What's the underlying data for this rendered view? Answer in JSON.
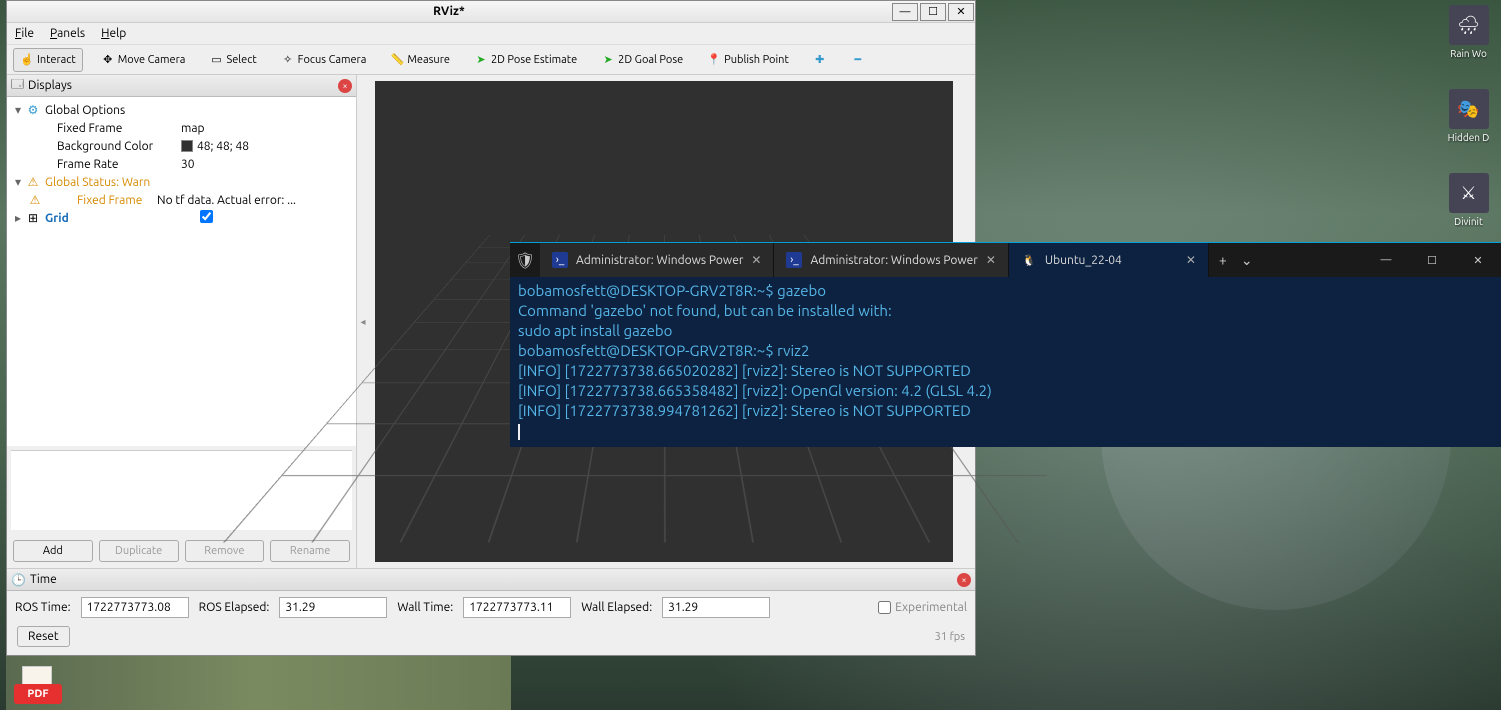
{
  "desktop": {
    "right_icons": [
      {
        "label": "Rain Wo"
      },
      {
        "label": "Hidden D"
      },
      {
        "label": "Divinit"
      }
    ],
    "pdf_label": "PDF"
  },
  "rviz": {
    "title": "RViz*",
    "menu": {
      "file": "File",
      "panels": "Panels",
      "help": "Help"
    },
    "toolbar": {
      "interact": "Interact",
      "move_camera": "Move Camera",
      "select": "Select",
      "focus_camera": "Focus Camera",
      "measure": "Measure",
      "pose_estimate": "2D Pose Estimate",
      "goal_pose": "2D Goal Pose",
      "publish_point": "Publish Point"
    },
    "displays": {
      "title": "Displays",
      "global_options": "Global Options",
      "fixed_frame_label": "Fixed Frame",
      "fixed_frame_value": "map",
      "bg_color_label": "Background Color",
      "bg_color_value": "48; 48; 48",
      "frame_rate_label": "Frame Rate",
      "frame_rate_value": "30",
      "global_status_label": "Global Status: Warn",
      "fixed_frame_warn_label": "Fixed Frame",
      "fixed_frame_warn_value": "No tf data.  Actual error: ...",
      "grid_label": "Grid",
      "buttons": {
        "add": "Add",
        "duplicate": "Duplicate",
        "remove": "Remove",
        "rename": "Rename"
      }
    },
    "time": {
      "title": "Time",
      "ros_time_label": "ROS Time:",
      "ros_time_value": "1722773773.08",
      "ros_elapsed_label": "ROS Elapsed:",
      "ros_elapsed_value": "31.29",
      "wall_time_label": "Wall Time:",
      "wall_time_value": "1722773773.11",
      "wall_elapsed_label": "Wall Elapsed:",
      "wall_elapsed_value": "31.29",
      "experimental": "Experimental",
      "reset": "Reset",
      "fps": "31 fps"
    }
  },
  "terminal": {
    "tabs": [
      {
        "label": "Administrator: Windows Power",
        "active": false,
        "icon": "ps"
      },
      {
        "label": "Administrator: Windows Power",
        "active": false,
        "icon": "ps"
      },
      {
        "label": "Ubuntu_22-04",
        "active": true,
        "icon": "tux"
      }
    ],
    "lines": [
      "bobamosfett@DESKTOP-GRV2T8R:~$ gazebo",
      "Command 'gazebo' not found, but can be installed with:",
      "sudo apt install gazebo",
      "bobamosfett@DESKTOP-GRV2T8R:~$ rviz2",
      "[INFO] [1722773738.665020282] [rviz2]: Stereo is NOT SUPPORTED",
      "[INFO] [1722773738.665358482] [rviz2]: OpenGl version: 4.2 (GLSL 4.2)",
      "[INFO] [1722773738.994781262] [rviz2]: Stereo is NOT SUPPORTED"
    ]
  }
}
